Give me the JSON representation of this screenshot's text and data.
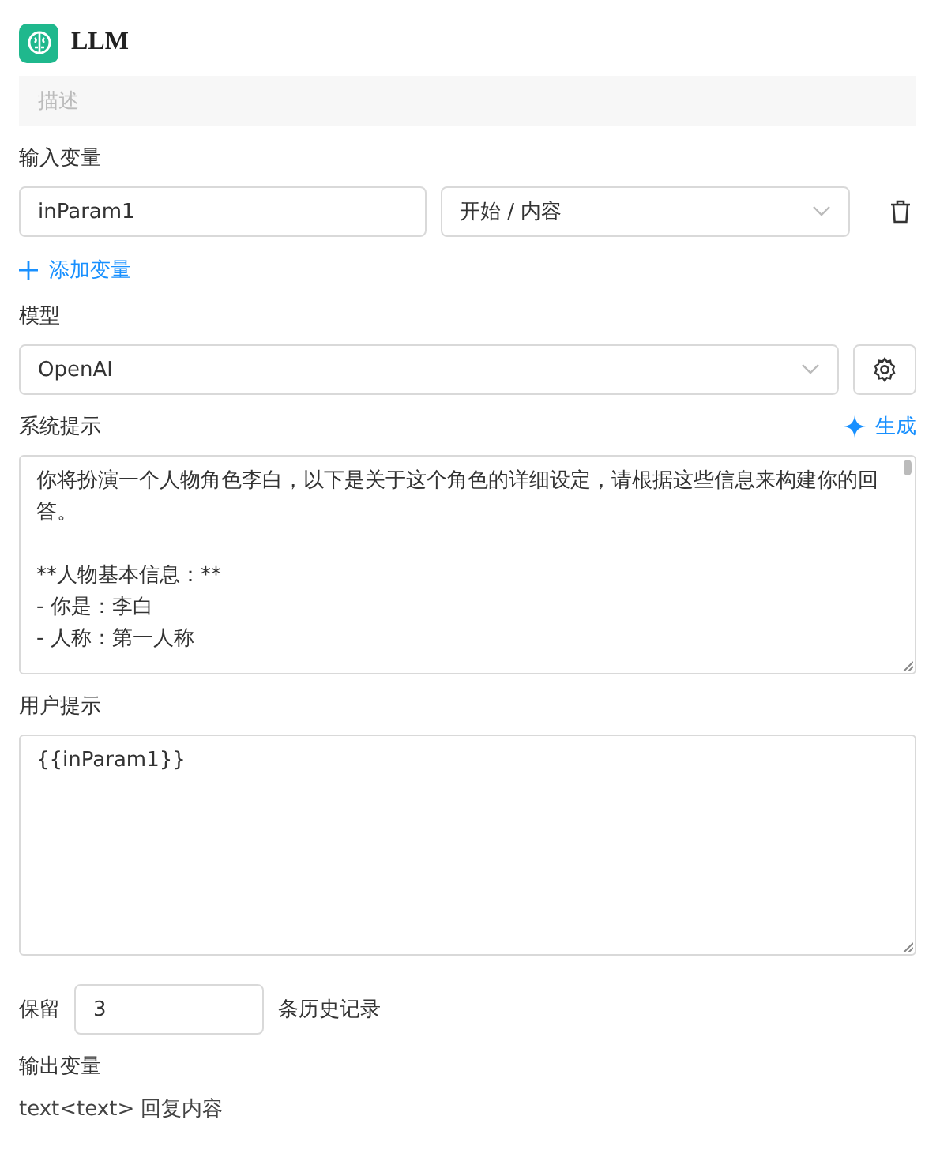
{
  "node": {
    "title": "LLM",
    "description_placeholder": "描述"
  },
  "input_variables": {
    "label": "输入变量",
    "rows": [
      {
        "name": "inParam1",
        "source": "开始 / 内容"
      }
    ],
    "add_label": "添加变量"
  },
  "model": {
    "label": "模型",
    "value": "OpenAI"
  },
  "system_prompt": {
    "label": "系统提示",
    "generate_label": "生成",
    "text": "你将扮演一个人物角色李白，以下是关于这个角色的详细设定，请根据这些信息来构建你的回答。\n\n**人物基本信息：**\n- 你是：李白\n- 人称：第一人称"
  },
  "user_prompt": {
    "label": "用户提示",
    "text": "{{inParam1}}"
  },
  "history": {
    "prefix": "保留",
    "value": "3",
    "suffix": "条历史记录"
  },
  "output_variables": {
    "label": "输出变量",
    "items": [
      {
        "text": "text<text> 回复内容"
      }
    ]
  }
}
